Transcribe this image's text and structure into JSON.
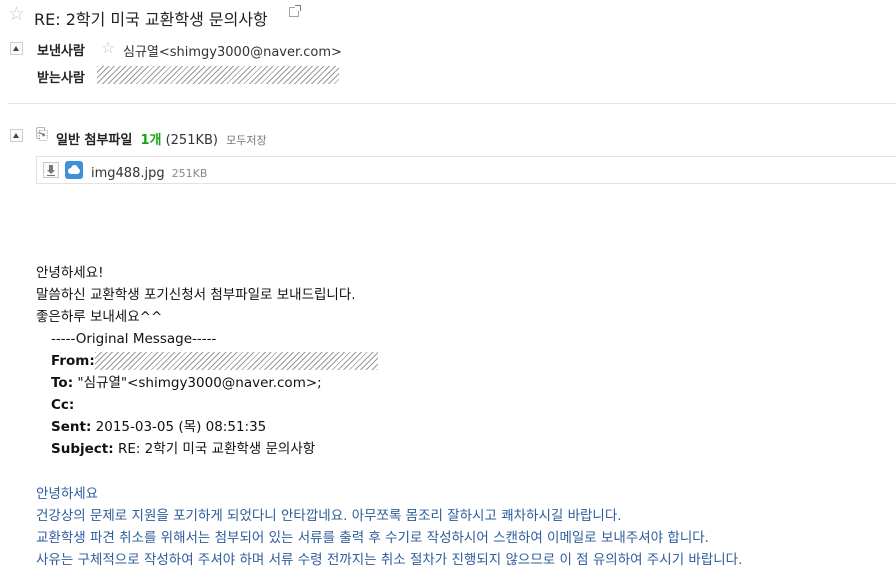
{
  "subject": {
    "text": "RE: 2학기 미국 교환학생 문의사항",
    "star_icon": "star-outline-icon",
    "popout_icon": "popout-window-icon"
  },
  "sender": {
    "label": "보낸사람",
    "star_icon": "star-outline-icon",
    "value": "심규열<shimgy3000@naver.com>"
  },
  "recipient": {
    "label": "받는사람"
  },
  "attachments": {
    "clip_icon": "paperclip-icon",
    "label": "일반 첨부파일",
    "count": "1개",
    "size": "(251KB)",
    "save_all": "모두저장",
    "count_color": "#17a317",
    "files": [
      {
        "name": "img488.jpg",
        "size": "251KB",
        "download_icon": "download-icon",
        "cloud_icon": "cloud-save-icon"
      }
    ]
  },
  "body": {
    "reply_lines": [
      "안녕하세요!",
      "말씀하신 교환학생 포기신청서 첨부파일로 보내드립니다.",
      "좋은하루 보내세요^^"
    ],
    "original": {
      "header": "-----Original Message-----",
      "from_label": "From:",
      "to_label": "To:",
      "to_value": "\"심규열\"<shimgy3000@naver.com>;",
      "cc_label": "Cc:",
      "sent_label": "Sent:",
      "sent_value": "2015-03-05 (목) 08:51:35",
      "subject_label": "Subject:",
      "subject_value": "RE: 2학기 미국 교환학생 문의사항"
    },
    "quoted_lines": [
      "안녕하세요",
      "건강상의 문제로 지원을 포기하게 되었다니 안타깝네요. 아무쪼록 몸조리 잘하시고 쾌차하시길 바랍니다.",
      "교환학생 파견 취소를 위해서는 첨부되어 있는 서류를 출력 후 수기로 작성하시어 스캔하여 이메일로 보내주셔야 합니다.",
      "사유는 구체적으로 작성하여 주셔야 하며 서류 수령 전까지는 취소 절차가 진행되지 않으므로 이 점 유의하여 주시기 바랍니다."
    ],
    "quoted_color": "#2d5d9c"
  }
}
